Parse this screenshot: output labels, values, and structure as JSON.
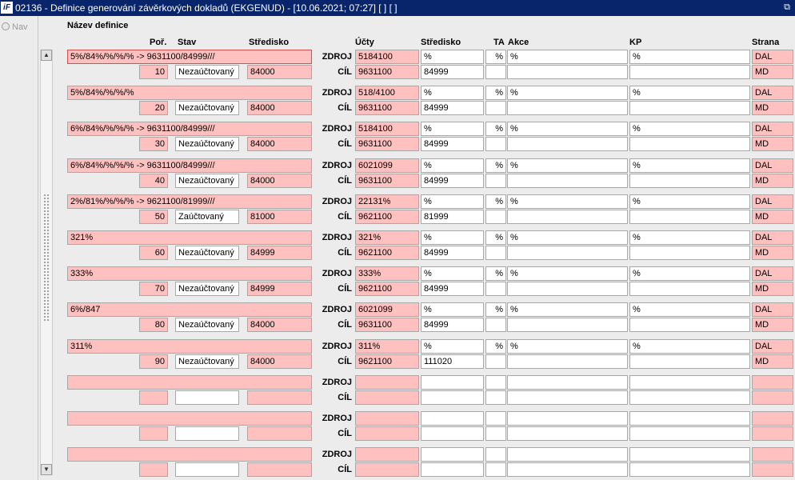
{
  "window": {
    "logo": "iF",
    "title": "02136 - Definice generování závěrkových dokladů (EKGENUD) - [10.06.2021; 07:27]  [ ]  [ ]"
  },
  "nav_label": "Nav",
  "section_title": "Název definice",
  "headers": {
    "por": "Poř.",
    "stav": "Stav",
    "stredisko_left": "Středisko",
    "ucty": "Účty",
    "stredisko_right": "Středisko",
    "ta": "TA",
    "akce": "Akce",
    "kp": "KP",
    "strana": "Strana"
  },
  "labels": {
    "zdroj": "ZDROJ",
    "cil": "CÍL"
  },
  "rows": [
    {
      "name": "5%/84%/%/%/% -> 9631100/84999///",
      "por": "10",
      "stav": "Nezaúčtovaný",
      "stredisko": "84000",
      "zdroj": {
        "ucet": "5184100",
        "stredisko": "%",
        "ta": "%",
        "akce": "%",
        "kp": "%",
        "strana": "DAL"
      },
      "cil": {
        "ucet": "9631100",
        "stredisko": "84999",
        "ta": "",
        "akce": "",
        "kp": "",
        "strana": "MD"
      }
    },
    {
      "name": "5%/84%/%/%/%",
      "por": "20",
      "stav": "Nezaúčtovaný",
      "stredisko": "84000",
      "zdroj": {
        "ucet": "518/4100",
        "stredisko": "%",
        "ta": "%",
        "akce": "%",
        "kp": "%",
        "strana": "DAL"
      },
      "cil": {
        "ucet": "9631100",
        "stredisko": "84999",
        "ta": "",
        "akce": "",
        "kp": "",
        "strana": "MD"
      }
    },
    {
      "name": "6%/84%/%/%/% -> 9631100/84999///",
      "por": "30",
      "stav": "Nezaúčtovaný",
      "stredisko": "84000",
      "zdroj": {
        "ucet": "5184100",
        "stredisko": "%",
        "ta": "%",
        "akce": "%",
        "kp": "%",
        "strana": "DAL"
      },
      "cil": {
        "ucet": "9631100",
        "stredisko": "84999",
        "ta": "",
        "akce": "",
        "kp": "",
        "strana": "MD"
      }
    },
    {
      "name": "6%/84%/%/%/% -> 9631100/84999///",
      "por": "40",
      "stav": "Nezaúčtovaný",
      "stredisko": "84000",
      "zdroj": {
        "ucet": "6021099",
        "stredisko": "%",
        "ta": "%",
        "akce": "%",
        "kp": "%",
        "strana": "DAL"
      },
      "cil": {
        "ucet": "9631100",
        "stredisko": "84999",
        "ta": "",
        "akce": "",
        "kp": "",
        "strana": "MD"
      }
    },
    {
      "name": "2%/81%/%/%/% -> 9621100/81999///",
      "por": "50",
      "stav": "Zaúčtovaný",
      "stredisko": "81000",
      "zdroj": {
        "ucet": "22131%",
        "stredisko": "%",
        "ta": "%",
        "akce": "%",
        "kp": "%",
        "strana": "DAL"
      },
      "cil": {
        "ucet": "9621100",
        "stredisko": "81999",
        "ta": "",
        "akce": "",
        "kp": "",
        "strana": "MD"
      }
    },
    {
      "name": "321%",
      "por": "60",
      "stav": "Nezaúčtovaný",
      "stredisko": "84999",
      "zdroj": {
        "ucet": "321%",
        "stredisko": "%",
        "ta": "%",
        "akce": "%",
        "kp": "%",
        "strana": "DAL"
      },
      "cil": {
        "ucet": "9621100",
        "stredisko": "84999",
        "ta": "",
        "akce": "",
        "kp": "",
        "strana": "MD"
      }
    },
    {
      "name": "333%",
      "por": "70",
      "stav": "Nezaúčtovaný",
      "stredisko": "84999",
      "zdroj": {
        "ucet": "333%",
        "stredisko": "%",
        "ta": "%",
        "akce": "%",
        "kp": "%",
        "strana": "DAL"
      },
      "cil": {
        "ucet": "9621100",
        "stredisko": "84999",
        "ta": "",
        "akce": "",
        "kp": "",
        "strana": "MD"
      }
    },
    {
      "name": "6%/847",
      "por": "80",
      "stav": "Nezaúčtovaný",
      "stredisko": "84000",
      "zdroj": {
        "ucet": "6021099",
        "stredisko": "%",
        "ta": "%",
        "akce": "%",
        "kp": "%",
        "strana": "DAL"
      },
      "cil": {
        "ucet": "9631100",
        "stredisko": "84999",
        "ta": "",
        "akce": "",
        "kp": "",
        "strana": "MD"
      }
    },
    {
      "name": "311%",
      "por": "90",
      "stav": "Nezaúčtovaný",
      "stredisko": "84000",
      "zdroj": {
        "ucet": "311%",
        "stredisko": "%",
        "ta": "%",
        "akce": "%",
        "kp": "%",
        "strana": "DAL"
      },
      "cil": {
        "ucet": "9621100",
        "stredisko": "111020",
        "ta": "",
        "akce": "",
        "kp": "",
        "strana": "MD"
      }
    },
    {
      "name": "",
      "por": "",
      "stav": "",
      "stredisko": "",
      "zdroj": {
        "ucet": "",
        "stredisko": "",
        "ta": "",
        "akce": "",
        "kp": "",
        "strana": ""
      },
      "cil": {
        "ucet": "",
        "stredisko": "",
        "ta": "",
        "akce": "",
        "kp": "",
        "strana": ""
      }
    },
    {
      "name": "",
      "por": "",
      "stav": "",
      "stredisko": "",
      "zdroj": {
        "ucet": "",
        "stredisko": "",
        "ta": "",
        "akce": "",
        "kp": "",
        "strana": ""
      },
      "cil": {
        "ucet": "",
        "stredisko": "",
        "ta": "",
        "akce": "",
        "kp": "",
        "strana": ""
      }
    },
    {
      "name": "",
      "por": "",
      "stav": "",
      "stredisko": "",
      "zdroj": {
        "ucet": "",
        "stredisko": "",
        "ta": "",
        "akce": "",
        "kp": "",
        "strana": ""
      },
      "cil": {
        "ucet": "",
        "stredisko": "",
        "ta": "",
        "akce": "",
        "kp": "",
        "strana": ""
      }
    }
  ]
}
